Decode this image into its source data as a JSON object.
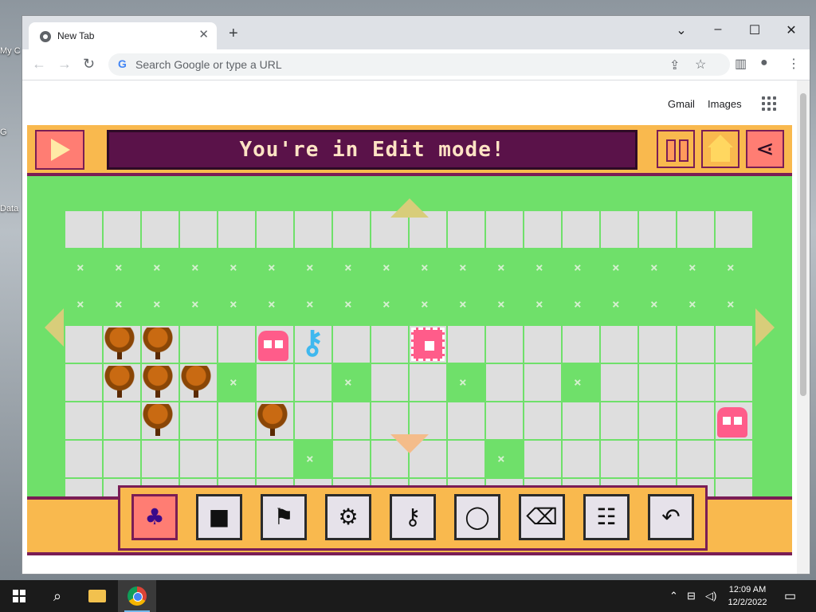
{
  "desktop": {
    "icons": [
      {
        "label": "My C",
        "icon": "computer-icon"
      },
      {
        "label": "G",
        "icon": "chrome-shortcut-icon"
      },
      {
        "label": "Data",
        "icon": "data-icon"
      }
    ]
  },
  "browser": {
    "tab": {
      "title": "New Tab",
      "favicon": "chrome-favicon-icon"
    },
    "new_tab_label": "+",
    "omnibox": {
      "placeholder": "Search Google or type a URL"
    },
    "window_controls": {
      "minimize": "–",
      "maximize": "☐",
      "close": "✕"
    },
    "nav": {
      "back": "←",
      "forward": "→",
      "reload": "↻"
    }
  },
  "page": {
    "gmail_link": "Gmail",
    "images_link": "Images"
  },
  "game": {
    "banner_text": "You're in Edit mode!",
    "colors": {
      "grass": "#6fe06a",
      "frame": "#f9b94e",
      "accent": "#7a1d55",
      "banner": "#5a1249"
    },
    "top_buttons": [
      "play-icon",
      "pause-icon",
      "home-icon",
      "share-icon"
    ],
    "palette_tools": [
      {
        "name": "tree-tool",
        "glyph": "♣",
        "selected": true
      },
      {
        "name": "wall-tool",
        "glyph": "■",
        "selected": false
      },
      {
        "name": "flag-tool",
        "glyph": "⚑",
        "selected": false
      },
      {
        "name": "goal-tool",
        "glyph": "⚙",
        "selected": false
      },
      {
        "name": "key-tool",
        "glyph": "⚷",
        "selected": false
      },
      {
        "name": "circle-tool",
        "glyph": "◯",
        "selected": false
      },
      {
        "name": "eraser-tool",
        "glyph": "⌫",
        "selected": false
      },
      {
        "name": "settings-tool",
        "glyph": "☷",
        "selected": false
      },
      {
        "name": "undo-tool",
        "glyph": "↶",
        "selected": false
      }
    ]
  },
  "taskbar": {
    "time": "12:09 AM",
    "date": "12/2/2022"
  }
}
